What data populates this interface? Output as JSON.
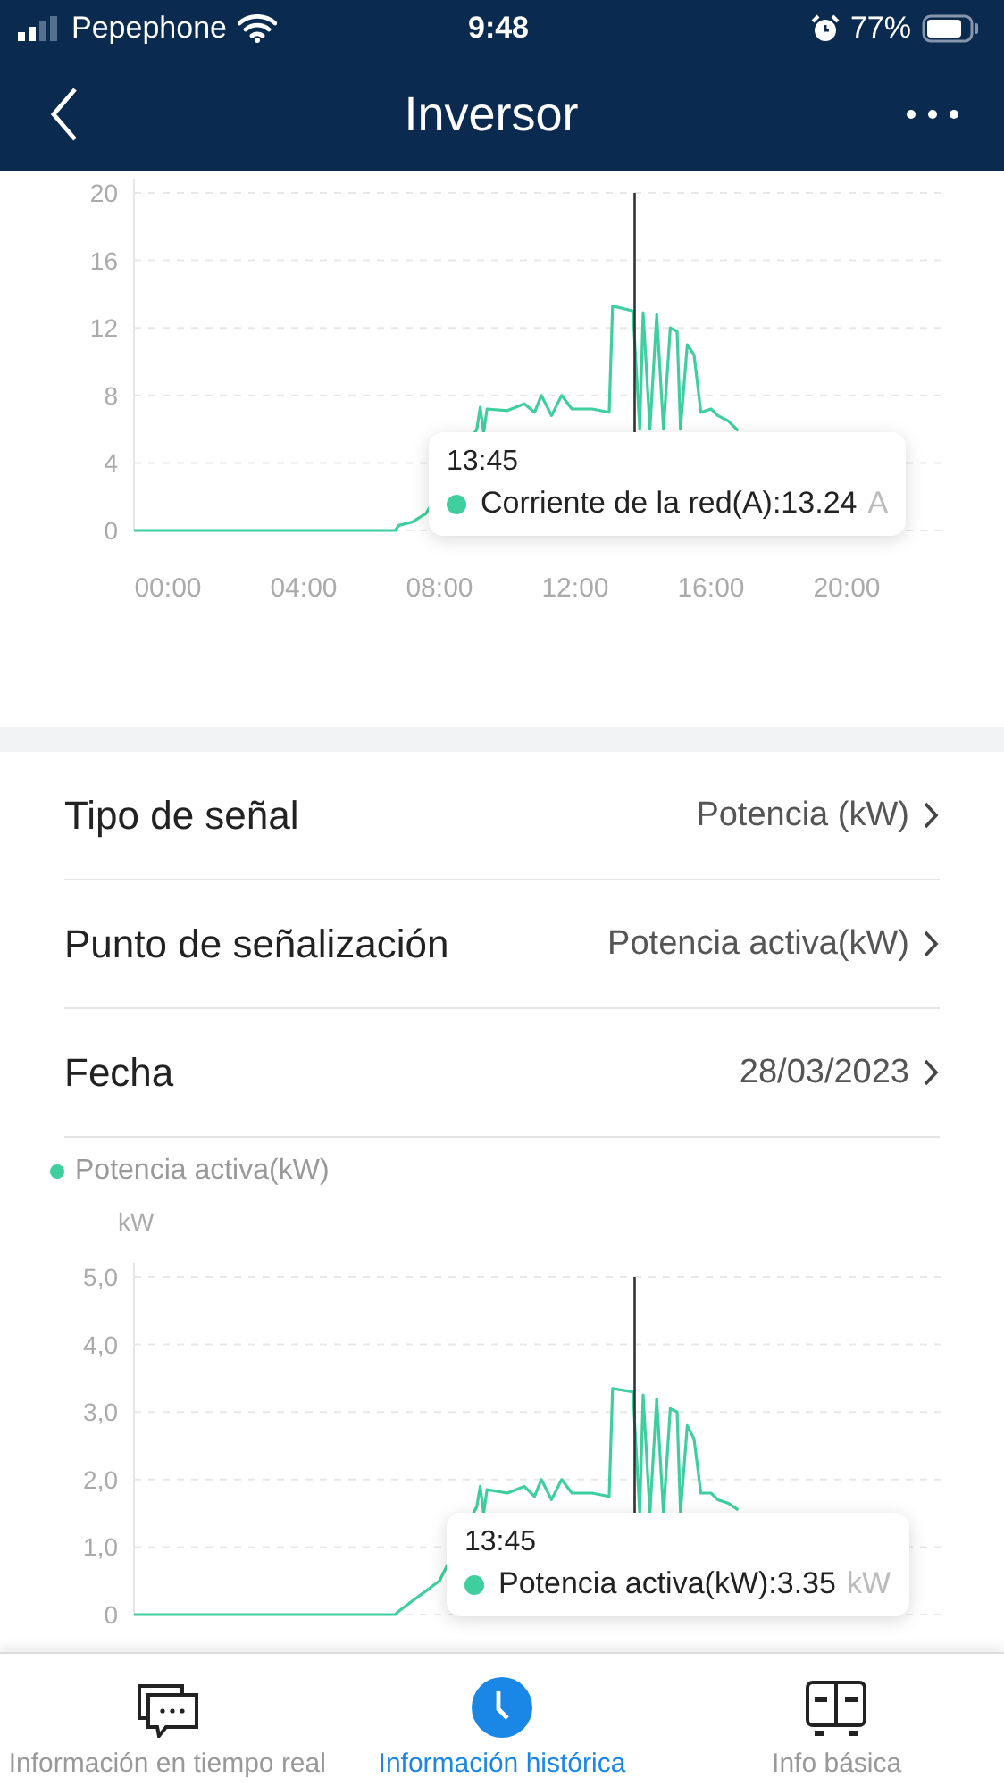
{
  "status_bar": {
    "carrier": "Pepephone",
    "time": "9:48",
    "battery": "77%"
  },
  "header": {
    "title": "Inversor"
  },
  "top_chart": {
    "chart_data": {
      "type": "line",
      "grid": true,
      "xlim": [
        -1,
        23
      ],
      "ylim": [
        0,
        20
      ],
      "xticks": [
        {
          "value": 0,
          "label": "00:00"
        },
        {
          "value": 4,
          "label": "04:00"
        },
        {
          "value": 8,
          "label": "08:00"
        },
        {
          "value": 12,
          "label": "12:00"
        },
        {
          "value": 16,
          "label": "16:00"
        },
        {
          "value": 20,
          "label": "20:00"
        }
      ],
      "yticks": [
        0,
        4,
        8,
        12,
        16,
        20
      ],
      "x": [
        -1,
        6.7,
        6.8,
        7.2,
        7.6,
        9.1,
        9.2,
        9.3,
        9.4,
        10,
        10.5,
        10.8,
        11,
        11.3,
        11.6,
        11.9,
        12.5,
        13,
        13.1,
        13.7,
        13.9,
        14,
        14.2,
        14.4,
        14.6,
        14.8,
        15,
        15.1,
        15.3,
        15.5,
        15.7,
        16,
        16.2,
        16.5,
        16.8
      ],
      "series": [
        {
          "color": "#3fcf9f",
          "values": [
            0,
            0,
            0.3,
            0.5,
            1,
            6,
            7.3,
            5.8,
            7.2,
            7.1,
            7.5,
            7,
            8,
            6.8,
            8,
            7.2,
            7.2,
            7,
            13.3,
            13,
            6,
            12.9,
            6,
            12.8,
            6,
            12,
            11.8,
            6,
            11,
            10.4,
            7,
            7.2,
            6.8,
            6.5,
            5.9
          ]
        }
      ],
      "ref_lines": [
        {
          "axis": "x",
          "value": 13.75
        }
      ]
    },
    "tooltip": {
      "time": "13:45",
      "text": "Corriente de la red(A):13.24",
      "unit": "A",
      "color": "#3fcf9f"
    }
  },
  "settings": [
    {
      "label": "Tipo de señal",
      "value": "Potencia (kW)"
    },
    {
      "label": "Punto de señalización",
      "value": "Potencia activa(kW)"
    },
    {
      "label": "Fecha",
      "value": "28/03/2023"
    }
  ],
  "bottom_chart": {
    "chart_data": {
      "type": "line",
      "grid": true,
      "ylabel": "kW",
      "xlim": [
        -1,
        23
      ],
      "ylim": [
        0,
        5
      ],
      "yticks": [
        {
          "value": 0,
          "label": "0"
        },
        {
          "value": 1,
          "label": "1,0"
        },
        {
          "value": 2,
          "label": "2,0"
        },
        {
          "value": 3,
          "label": "3,0"
        },
        {
          "value": 4,
          "label": "4,0"
        },
        {
          "value": 5,
          "label": "5,0"
        }
      ],
      "x": [
        -1,
        6.7,
        6.8,
        7.2,
        7.6,
        8,
        9.1,
        9.2,
        9.3,
        9.4,
        10,
        10.5,
        10.8,
        11,
        11.3,
        11.6,
        11.9,
        12.5,
        13,
        13.1,
        13.7,
        13.9,
        14,
        14.2,
        14.4,
        14.6,
        14.8,
        15,
        15.1,
        15.3,
        15.5,
        15.7,
        16,
        16.2,
        16.5,
        16.8
      ],
      "series": [
        {
          "name": "Potencia activa(kW)",
          "color": "#3fcf9f",
          "values": [
            0,
            0,
            0.05,
            0.2,
            0.35,
            0.5,
            1.6,
            1.9,
            1.5,
            1.85,
            1.8,
            1.9,
            1.75,
            2,
            1.7,
            2,
            1.8,
            1.8,
            1.75,
            3.35,
            3.3,
            1.5,
            3.25,
            1.5,
            3.2,
            1.5,
            3.05,
            3,
            1.5,
            2.8,
            2.6,
            1.8,
            1.8,
            1.7,
            1.65,
            1.55
          ]
        }
      ],
      "ref_lines": [
        {
          "axis": "x",
          "value": 13.75
        }
      ]
    },
    "tooltip": {
      "time": "13:45",
      "text": "Potencia activa(kW):3.35",
      "unit": "kW",
      "color": "#3fcf9f"
    }
  },
  "tab_bar": [
    {
      "kind": "chat",
      "label": "Información en tiempo real",
      "selected": false
    },
    {
      "kind": "clock",
      "label": "Información histórica",
      "selected": true
    },
    {
      "kind": "cabinet",
      "label": "Info básica",
      "selected": false
    }
  ]
}
